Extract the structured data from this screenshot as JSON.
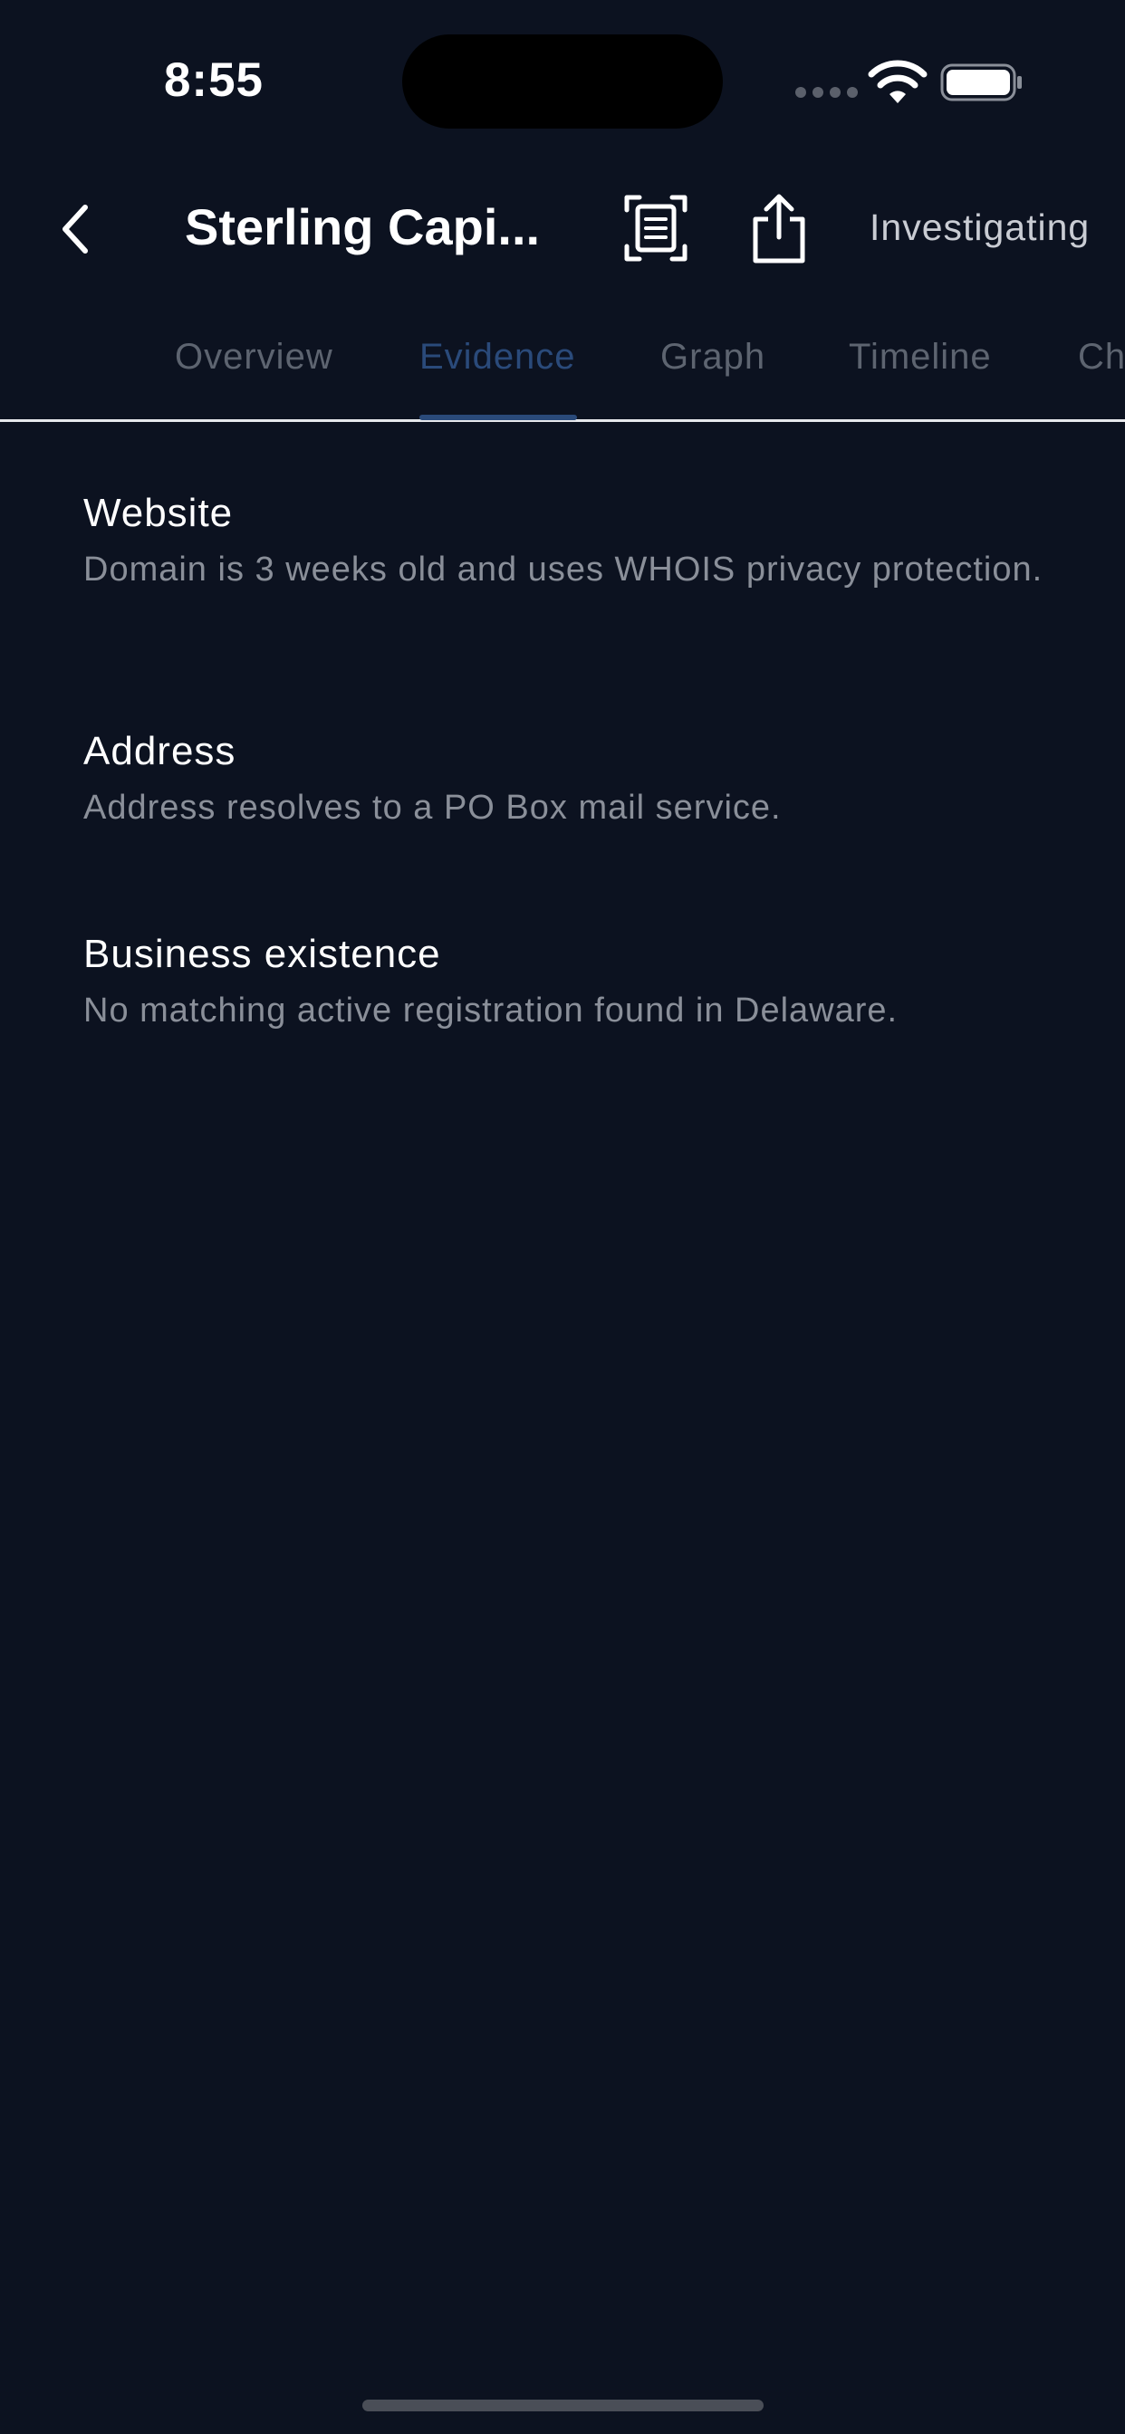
{
  "status_bar": {
    "time": "8:55"
  },
  "nav": {
    "back_icon": "chevron-left-icon",
    "title": "Sterling Capi...",
    "scan_icon": "document-scan-icon",
    "share_icon": "share-icon",
    "status": "Investigating"
  },
  "tabs": [
    {
      "label": "Overview",
      "active": false
    },
    {
      "label": "Evidence",
      "active": true
    },
    {
      "label": "Graph",
      "active": false
    },
    {
      "label": "Timeline",
      "active": false
    },
    {
      "label": "Ch",
      "active": false
    }
  ],
  "evidence": [
    {
      "title": "Website",
      "description": "Domain is 3 weeks old and uses WHOIS privacy protection."
    },
    {
      "title": "Address",
      "description": "Address resolves to a PO Box mail service."
    },
    {
      "title": "Business existence",
      "description": "No matching active registration found in Delaware."
    }
  ],
  "colors": {
    "background": "#0c1220",
    "active_tab": "#2a4a7a",
    "inactive_tab": "#5d6470",
    "secondary_text": "#8a8f99"
  }
}
